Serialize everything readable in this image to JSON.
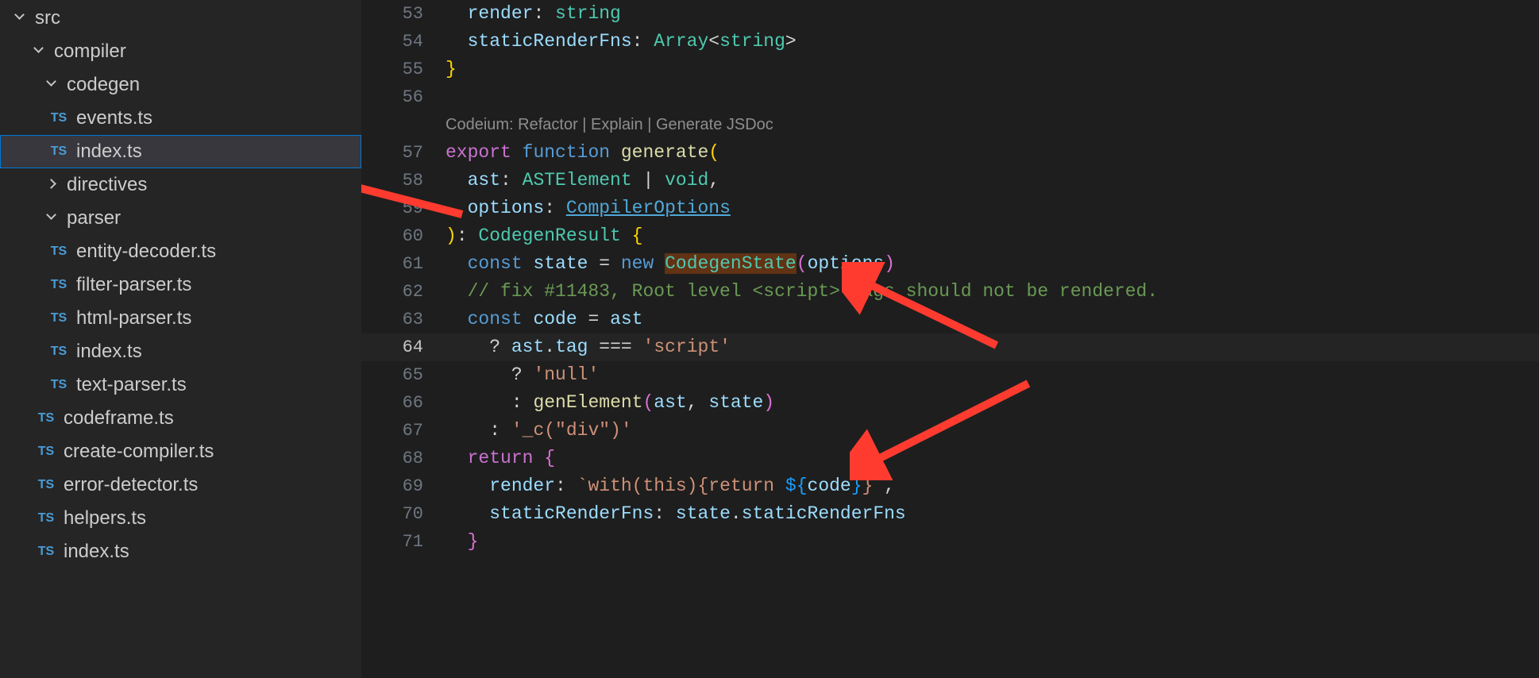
{
  "sidebar": {
    "tree": [
      {
        "label": "src",
        "indent": 16,
        "twisty": "expanded",
        "icon": null,
        "selected": false
      },
      {
        "label": "compiler",
        "indent": 40,
        "twisty": "expanded",
        "icon": null,
        "selected": false
      },
      {
        "label": "codegen",
        "indent": 56,
        "twisty": "expanded",
        "icon": null,
        "selected": false
      },
      {
        "label": "events.ts",
        "indent": 60,
        "twisty": null,
        "icon": "TS",
        "selected": false
      },
      {
        "label": "index.ts",
        "indent": 60,
        "twisty": null,
        "icon": "TS",
        "selected": true
      },
      {
        "label": "directives",
        "indent": 56,
        "twisty": "collapsed",
        "icon": null,
        "selected": false
      },
      {
        "label": "parser",
        "indent": 56,
        "twisty": "expanded",
        "icon": null,
        "selected": false
      },
      {
        "label": "entity-decoder.ts",
        "indent": 60,
        "twisty": null,
        "icon": "TS",
        "selected": false
      },
      {
        "label": "filter-parser.ts",
        "indent": 60,
        "twisty": null,
        "icon": "TS",
        "selected": false
      },
      {
        "label": "html-parser.ts",
        "indent": 60,
        "twisty": null,
        "icon": "TS",
        "selected": false
      },
      {
        "label": "index.ts",
        "indent": 60,
        "twisty": null,
        "icon": "TS",
        "selected": false
      },
      {
        "label": "text-parser.ts",
        "indent": 60,
        "twisty": null,
        "icon": "TS",
        "selected": false
      },
      {
        "label": "codeframe.ts",
        "indent": 44,
        "twisty": null,
        "icon": "TS",
        "selected": false
      },
      {
        "label": "create-compiler.ts",
        "indent": 44,
        "twisty": null,
        "icon": "TS",
        "selected": false
      },
      {
        "label": "error-detector.ts",
        "indent": 44,
        "twisty": null,
        "icon": "TS",
        "selected": false
      },
      {
        "label": "helpers.ts",
        "indent": 44,
        "twisty": null,
        "icon": "TS",
        "selected": false
      },
      {
        "label": "index.ts",
        "indent": 44,
        "twisty": null,
        "icon": "TS",
        "selected": false
      }
    ]
  },
  "codelens": "Codeium: Refactor | Explain | Generate JSDoc",
  "editor": {
    "currentLine": 64,
    "lines": [
      {
        "num": 53,
        "tokens": [
          {
            "t": "  ",
            "c": "pn"
          },
          {
            "t": "render",
            "c": "id"
          },
          {
            "t": ": ",
            "c": "pn"
          },
          {
            "t": "string",
            "c": "ty"
          }
        ]
      },
      {
        "num": 54,
        "tokens": [
          {
            "t": "  ",
            "c": "pn"
          },
          {
            "t": "staticRenderFns",
            "c": "id"
          },
          {
            "t": ": ",
            "c": "pn"
          },
          {
            "t": "Array",
            "c": "ty"
          },
          {
            "t": "<",
            "c": "pn"
          },
          {
            "t": "string",
            "c": "ty"
          },
          {
            "t": ">",
            "c": "pn"
          }
        ]
      },
      {
        "num": 55,
        "tokens": [
          {
            "t": "}",
            "c": "brY"
          }
        ]
      },
      {
        "num": 56,
        "tokens": []
      },
      {
        "codelens": true
      },
      {
        "num": 57,
        "tokens": [
          {
            "t": "export",
            "c": "k"
          },
          {
            "t": " ",
            "c": "pn"
          },
          {
            "t": "function",
            "c": "kw2"
          },
          {
            "t": " ",
            "c": "pn"
          },
          {
            "t": "generate",
            "c": "fn"
          },
          {
            "t": "(",
            "c": "brY"
          }
        ]
      },
      {
        "num": 58,
        "tokens": [
          {
            "t": "  ",
            "c": "pn"
          },
          {
            "t": "ast",
            "c": "id"
          },
          {
            "t": ": ",
            "c": "pn"
          },
          {
            "t": "ASTElement",
            "c": "ty"
          },
          {
            "t": " | ",
            "c": "pn"
          },
          {
            "t": "void",
            "c": "ty"
          },
          {
            "t": ",",
            "c": "pn"
          }
        ]
      },
      {
        "num": 59,
        "tokens": [
          {
            "t": "  ",
            "c": "pn"
          },
          {
            "t": "options",
            "c": "id"
          },
          {
            "t": ": ",
            "c": "pn"
          },
          {
            "t": "CompilerOptions",
            "c": "lnk"
          }
        ]
      },
      {
        "num": 60,
        "tokens": [
          {
            "t": ")",
            "c": "brY"
          },
          {
            "t": ": ",
            "c": "pn"
          },
          {
            "t": "CodegenResult",
            "c": "ty"
          },
          {
            "t": " ",
            "c": "pn"
          },
          {
            "t": "{",
            "c": "brY"
          }
        ]
      },
      {
        "num": 61,
        "tokens": [
          {
            "t": "  ",
            "c": "pn"
          },
          {
            "t": "const",
            "c": "kw2"
          },
          {
            "t": " ",
            "c": "pn"
          },
          {
            "t": "state",
            "c": "id"
          },
          {
            "t": " = ",
            "c": "pn"
          },
          {
            "t": "new",
            "c": "kw2"
          },
          {
            "t": " ",
            "c": "pn"
          },
          {
            "t": "CodegenState",
            "c": "hl"
          },
          {
            "t": "(",
            "c": "brP"
          },
          {
            "t": "options",
            "c": "id"
          },
          {
            "t": ")",
            "c": "brP"
          }
        ]
      },
      {
        "num": 62,
        "tokens": [
          {
            "t": "  ",
            "c": "pn"
          },
          {
            "t": "// fix #11483, Root level <script> tags should not be rendered.",
            "c": "cm"
          }
        ]
      },
      {
        "num": 63,
        "tokens": [
          {
            "t": "  ",
            "c": "pn"
          },
          {
            "t": "const",
            "c": "kw2"
          },
          {
            "t": " ",
            "c": "pn"
          },
          {
            "t": "code",
            "c": "id"
          },
          {
            "t": " = ",
            "c": "pn"
          },
          {
            "t": "ast",
            "c": "id"
          }
        ]
      },
      {
        "num": 64,
        "tokens": [
          {
            "t": "    ",
            "c": "pn"
          },
          {
            "t": "?",
            "c": "pn"
          },
          {
            "t": " ",
            "c": "pn"
          },
          {
            "t": "ast",
            "c": "id"
          },
          {
            "t": ".",
            "c": "pn"
          },
          {
            "t": "tag",
            "c": "id"
          },
          {
            "t": " === ",
            "c": "pn"
          },
          {
            "t": "'script'",
            "c": "str"
          }
        ]
      },
      {
        "num": 65,
        "tokens": [
          {
            "t": "      ",
            "c": "pn"
          },
          {
            "t": "?",
            "c": "pn"
          },
          {
            "t": " ",
            "c": "pn"
          },
          {
            "t": "'null'",
            "c": "str"
          }
        ]
      },
      {
        "num": 66,
        "tokens": [
          {
            "t": "      ",
            "c": "pn"
          },
          {
            "t": ":",
            "c": "pn"
          },
          {
            "t": " ",
            "c": "pn"
          },
          {
            "t": "genElement",
            "c": "fn"
          },
          {
            "t": "(",
            "c": "brP"
          },
          {
            "t": "ast",
            "c": "id"
          },
          {
            "t": ", ",
            "c": "pn"
          },
          {
            "t": "state",
            "c": "id"
          },
          {
            "t": ")",
            "c": "brP"
          }
        ]
      },
      {
        "num": 67,
        "tokens": [
          {
            "t": "    ",
            "c": "pn"
          },
          {
            "t": ":",
            "c": "pn"
          },
          {
            "t": " ",
            "c": "pn"
          },
          {
            "t": "'_c(\"div\")'",
            "c": "str"
          }
        ]
      },
      {
        "num": 68,
        "tokens": [
          {
            "t": "  ",
            "c": "pn"
          },
          {
            "t": "return",
            "c": "k"
          },
          {
            "t": " ",
            "c": "pn"
          },
          {
            "t": "{",
            "c": "brP"
          }
        ]
      },
      {
        "num": 69,
        "tokens": [
          {
            "t": "    ",
            "c": "pn"
          },
          {
            "t": "render",
            "c": "id"
          },
          {
            "t": ": ",
            "c": "pn"
          },
          {
            "t": "`with(this){return ",
            "c": "str"
          },
          {
            "t": "${",
            "c": "brB"
          },
          {
            "t": "code",
            "c": "id"
          },
          {
            "t": "}",
            "c": "brB"
          },
          {
            "t": "}`",
            "c": "str"
          },
          {
            "t": ",",
            "c": "pn"
          }
        ]
      },
      {
        "num": 70,
        "tokens": [
          {
            "t": "    ",
            "c": "pn"
          },
          {
            "t": "staticRenderFns",
            "c": "id"
          },
          {
            "t": ": ",
            "c": "pn"
          },
          {
            "t": "state",
            "c": "id"
          },
          {
            "t": ".",
            "c": "pn"
          },
          {
            "t": "staticRenderFns",
            "c": "id"
          }
        ]
      },
      {
        "num": 71,
        "tokens": [
          {
            "t": "  ",
            "c": "pn"
          },
          {
            "t": "}",
            "c": "brP"
          }
        ]
      }
    ]
  }
}
